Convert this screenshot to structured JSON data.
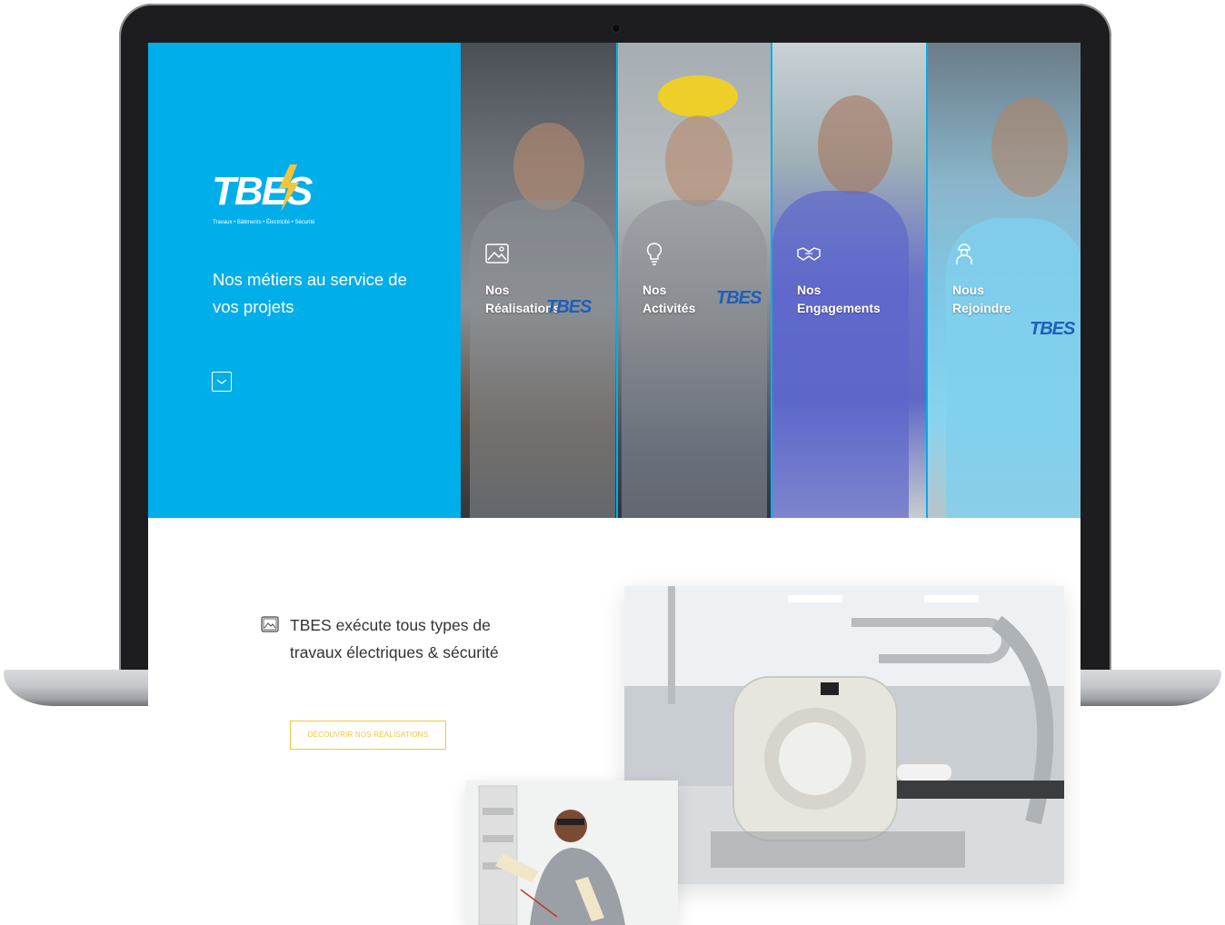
{
  "brand": {
    "logo_text": "TBES",
    "tagline": "Travaux • Bâtiments • Électricité • Sécurité",
    "colors": {
      "primary": "#00aeea",
      "accent_yellow": "#f6c43a",
      "logo_bolt": "#f6c43a",
      "text_dark": "#333333"
    }
  },
  "hero": {
    "title": "Nos métiers au service de vos projets",
    "scroll_icon": "chevron-down-icon"
  },
  "panels": [
    {
      "label_line1": "Nos",
      "label_line2": "Réalisations",
      "icon": "image-gallery-icon",
      "shirt_brand": "TBES"
    },
    {
      "label_line1": "Nos",
      "label_line2": "Activités",
      "icon": "lightbulb-icon",
      "shirt_brand": "TBES"
    },
    {
      "label_line1": "Nos",
      "label_line2": "Engagements",
      "icon": "handshake-icon",
      "shirt_brand": ""
    },
    {
      "label_line1": "Nous",
      "label_line2": "Rejoindre",
      "icon": "worker-icon",
      "shirt_brand": "TBES"
    }
  ],
  "realisations": {
    "icon": "image-gallery-icon",
    "intro": "TBES exécute tous types de travaux électriques & sécurité",
    "cta_label": "DÉCOUVRIR NOS RÉALISATIONS"
  },
  "photos": [
    {
      "name": "scanner-room-photo",
      "subject": "medical-scanner-icon"
    },
    {
      "name": "electrician-photo",
      "subject": "electrician-icon"
    }
  ]
}
